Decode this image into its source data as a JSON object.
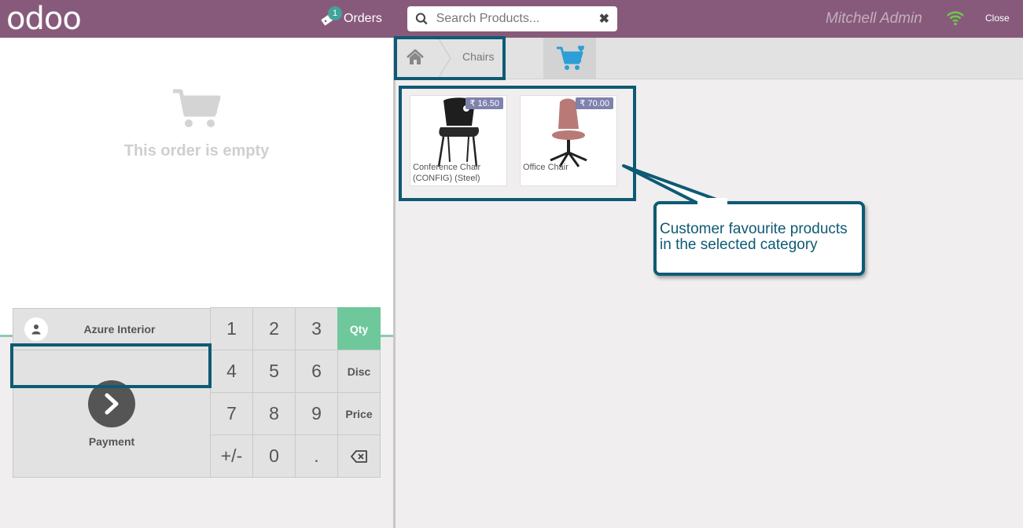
{
  "header": {
    "logo": "odoo",
    "orders_label": "Orders",
    "orders_count": "1",
    "search_placeholder": "Search Products...",
    "user_name": "Mitchell Admin",
    "close_label": "Close"
  },
  "order": {
    "empty_message": "This order is empty"
  },
  "actionpad": {
    "customer_name": "Azure Interior",
    "payment_label": "Payment"
  },
  "numpad": {
    "keys": [
      "1",
      "2",
      "3",
      "Qty",
      "4",
      "5",
      "6",
      "Disc",
      "7",
      "8",
      "9",
      "Price",
      "+/-",
      "0",
      "."
    ],
    "selected_mode": "Qty"
  },
  "breadcrumb": {
    "category": "Chairs"
  },
  "products": [
    {
      "name": "Conference Chair (CONFIG) (Steel)",
      "price": "₹ 16.50"
    },
    {
      "name": "Office Chair",
      "price": "₹ 70.00"
    }
  ],
  "annotation": {
    "callout_text_line1": "Customer favourite products",
    "callout_text_line2": "in the selected category"
  },
  "colors": {
    "header": "#875a7b",
    "selected_key": "#6ec89b",
    "annotation": "#0e5a74",
    "price_tag": "#7f82ac",
    "favourite_icon": "#2b9fd6"
  }
}
